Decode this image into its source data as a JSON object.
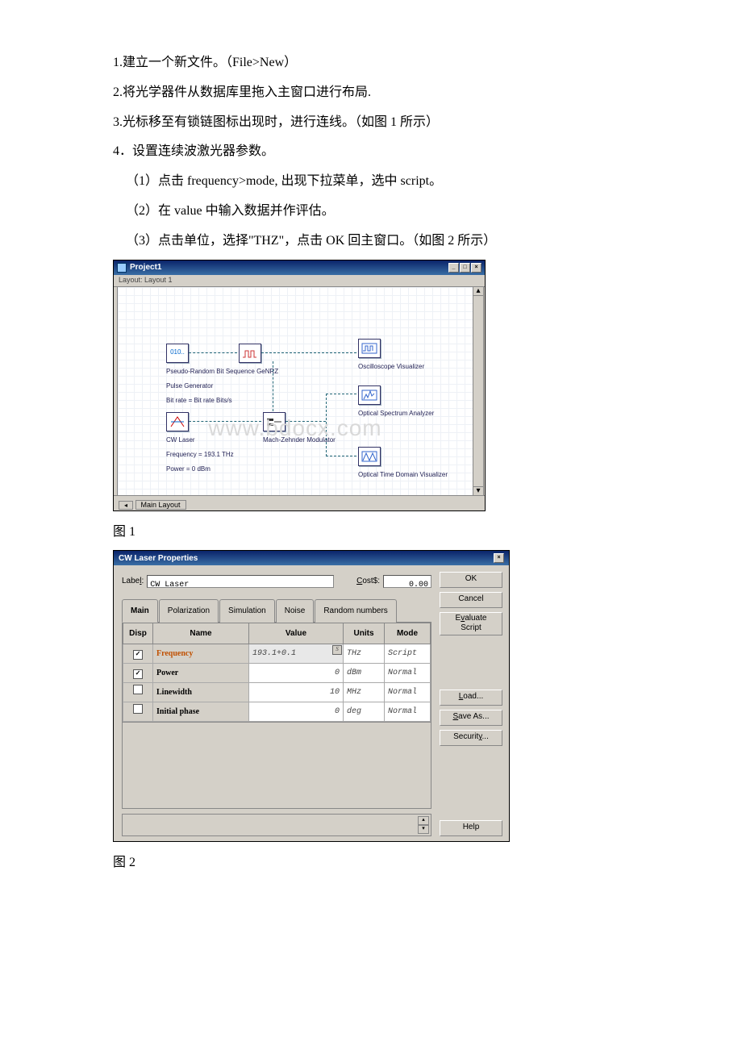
{
  "instructions": {
    "step1": "1.建立一个新文件。（File>New）",
    "step2": "2.将光学器件从数据库里拖入主窗口进行布局.",
    "step3": "3.光标移至有锁链图标出现时，进行连线。（如图 1 所示）",
    "step4": "4．设置连续波激光器参数。",
    "step4_1": "（1）点击 frequency>mode, 出现下拉菜单，选中 script。",
    "step4_2": "（2）在 value 中输入数据并作评估。",
    "step4_3": "（3）点击单位，选择\"THZ\"，点击 OK 回主窗口。（如图 2 所示）"
  },
  "fig1": {
    "window_title": "Project1",
    "layout_tab": "Layout: Layout 1",
    "bottom_tab": "Main Layout",
    "components": {
      "prbs": {
        "icon": "010..",
        "label": "Pseudo-Random Bit Sequence Ge",
        "sub": "Bit rate = Bit rate  Bits/s"
      },
      "nrz": {
        "label": "NRZ Pulse Generator"
      },
      "osc": {
        "label": "Oscilloscope Visualizer"
      },
      "cw": {
        "label": "CW Laser",
        "sub1": "Frequency = 193.1  THz",
        "sub2": "Power = 0  dBm"
      },
      "mzm": {
        "label": "Mach-Zehnder Modulator"
      },
      "osa": {
        "label": "Optical Spectrum Analyzer"
      },
      "otdv": {
        "label": "Optical Time Domain Visualizer"
      }
    },
    "watermark": "www.bdocx.com"
  },
  "fig1_caption": "图 1",
  "fig2": {
    "window_title": "CW Laser Properties",
    "label_caption": "Label:",
    "label_value": "CW Laser",
    "cost_caption": "Cost$:",
    "cost_value": "0.00",
    "tabs": [
      "Main",
      "Polarization",
      "Simulation",
      "Noise",
      "Random numbers"
    ],
    "grid_headers": {
      "disp": "Disp",
      "name": "Name",
      "value": "Value",
      "units": "Units",
      "mode": "Mode"
    },
    "rows": [
      {
        "disp": true,
        "name": "Frequency",
        "name_hot": true,
        "value": "193.1+0.1",
        "value_script": true,
        "units": "THz",
        "mode": "Script"
      },
      {
        "disp": true,
        "name": "Power",
        "value": "0",
        "units": "dBm",
        "mode": "Normal"
      },
      {
        "disp": false,
        "name": "Linewidth",
        "value": "10",
        "units": "MHz",
        "mode": "Normal"
      },
      {
        "disp": false,
        "name": "Initial phase",
        "value": "0",
        "units": "deg",
        "mode": "Normal"
      }
    ],
    "buttons": {
      "ok": "OK",
      "cancel": "Cancel",
      "eval": "Evaluate Script",
      "load": "Load...",
      "save": "Save As...",
      "security": "Security...",
      "help": "Help"
    }
  },
  "fig2_caption": "图 2"
}
